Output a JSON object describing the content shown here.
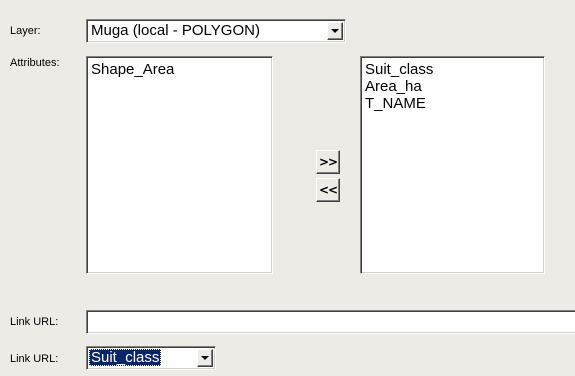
{
  "layer": {
    "label": "Layer:",
    "selected": "Muga (local - POLYGON)"
  },
  "attributes": {
    "label": "Attributes:",
    "available": [
      "Shape_Area"
    ],
    "selected": [
      "Suit_class",
      "Area_ha",
      "T_NAME"
    ],
    "add_button": ">>",
    "remove_button": "<<"
  },
  "link_url_text": {
    "label": "Link URL:",
    "value": ""
  },
  "link_url_field": {
    "label": "Link URL:",
    "selected": "Suit_class"
  }
}
